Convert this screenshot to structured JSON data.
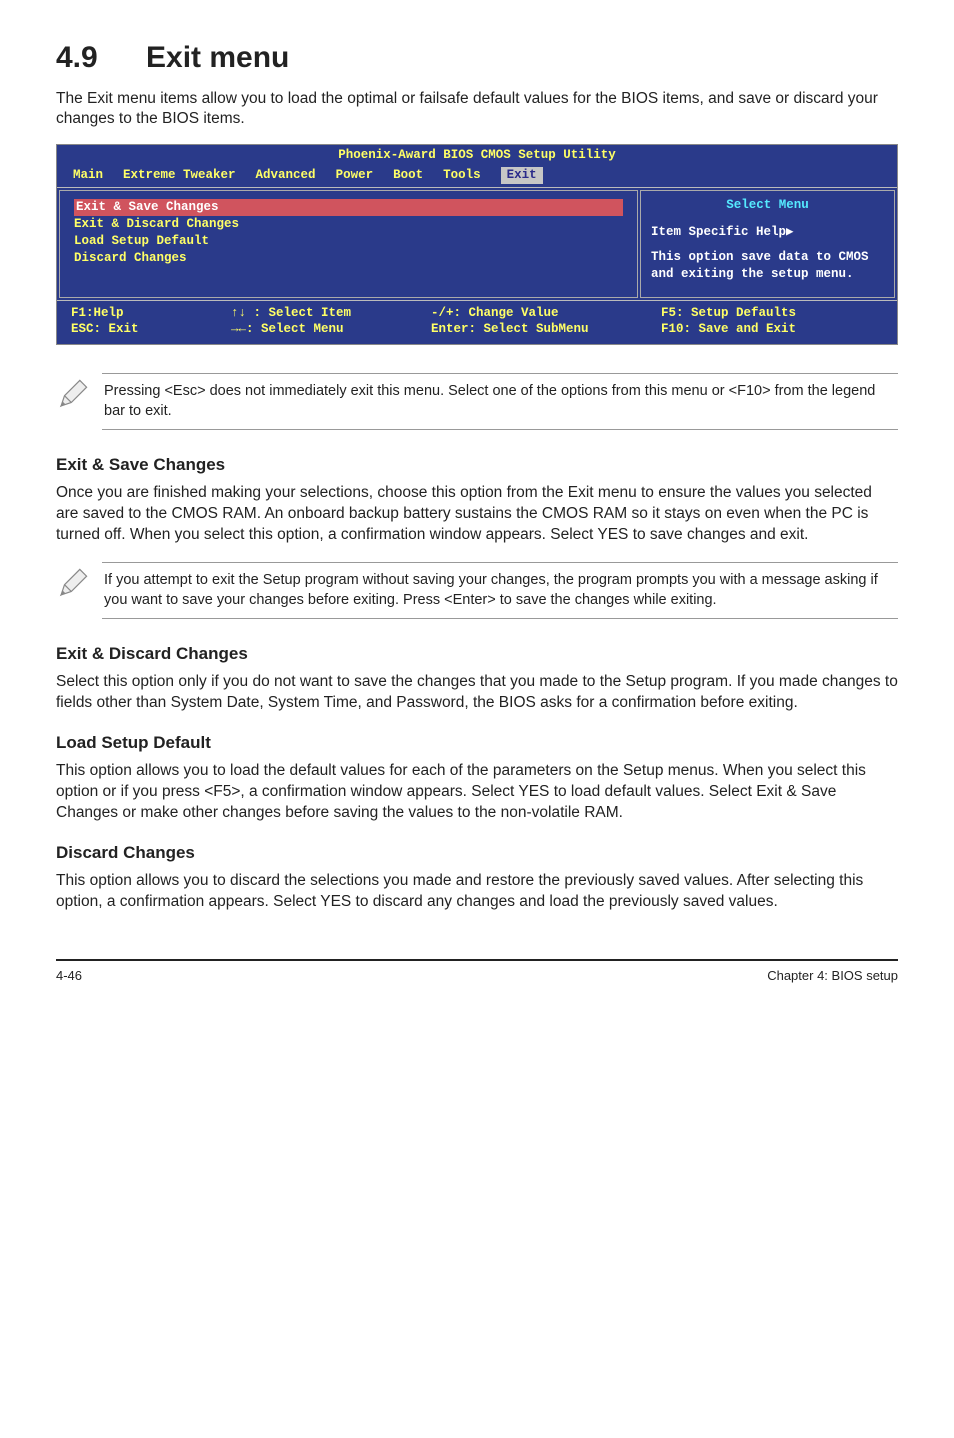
{
  "heading": {
    "number": "4.9",
    "title": "Exit menu"
  },
  "intro": "The Exit menu items allow you to load the optimal or failsafe default values for the BIOS items, and save or discard your changes to the BIOS items.",
  "bios": {
    "title": "Phoenix-Award BIOS CMOS Setup Utility",
    "tabs": [
      "Main",
      "Extreme Tweaker",
      "Advanced",
      "Power",
      "Boot",
      "Tools",
      "Exit"
    ],
    "selected_tab": "Exit",
    "items": [
      "Exit & Save Changes",
      "Exit & Discard Changes",
      "Load Setup Default",
      "Discard Changes"
    ],
    "right": {
      "header": "Select Menu",
      "help_label": "Item Specific Help▶",
      "desc": "This option save data to CMOS and exiting the setup menu."
    },
    "footer": {
      "c1a": "F1:Help",
      "c2a": "↑↓ : Select Item",
      "c3a": "-/+: Change Value",
      "c4a": "F5: Setup Defaults",
      "c1b": "ESC: Exit",
      "c2b": "→←: Select Menu",
      "c3b": "Enter: Select SubMenu",
      "c4b": "F10: Save and Exit"
    }
  },
  "note1": "Pressing <Esc> does not immediately exit this menu. Select one of the options from this menu or <F10> from the legend bar to exit.",
  "sections": {
    "s1": {
      "title": "Exit & Save Changes",
      "body": "Once you are finished making your selections, choose this option from the Exit menu to ensure the values you selected are saved to the CMOS RAM. An onboard backup battery sustains the CMOS RAM so it stays on even when the PC is turned off. When you select this option, a confirmation window appears. Select YES to save changes and exit."
    },
    "note2": "If you attempt to exit the Setup program without saving your changes, the program prompts you with a message asking if you want to save your changes before exiting. Press <Enter> to save the changes while exiting.",
    "s2": {
      "title": "Exit & Discard Changes",
      "body": "Select this option only if you do not want to save the changes that you made to the Setup program. If you made changes to fields other than System Date, System Time, and Password, the BIOS asks for a confirmation before exiting."
    },
    "s3": {
      "title": "Load Setup Default",
      "body": "This option allows you to load the default values for each of the parameters on the Setup menus. When you select this option or if you press <F5>, a confirmation window appears. Select YES to load default values. Select Exit & Save Changes or make other changes before saving the values to the non-volatile RAM."
    },
    "s4": {
      "title": "Discard Changes",
      "body": "This option allows you to discard the selections you made and restore the previously saved values. After selecting this option, a confirmation appears. Select YES to discard any changes and load the previously saved values."
    }
  },
  "footer": {
    "left": "4-46",
    "right": "Chapter 4: BIOS setup"
  }
}
